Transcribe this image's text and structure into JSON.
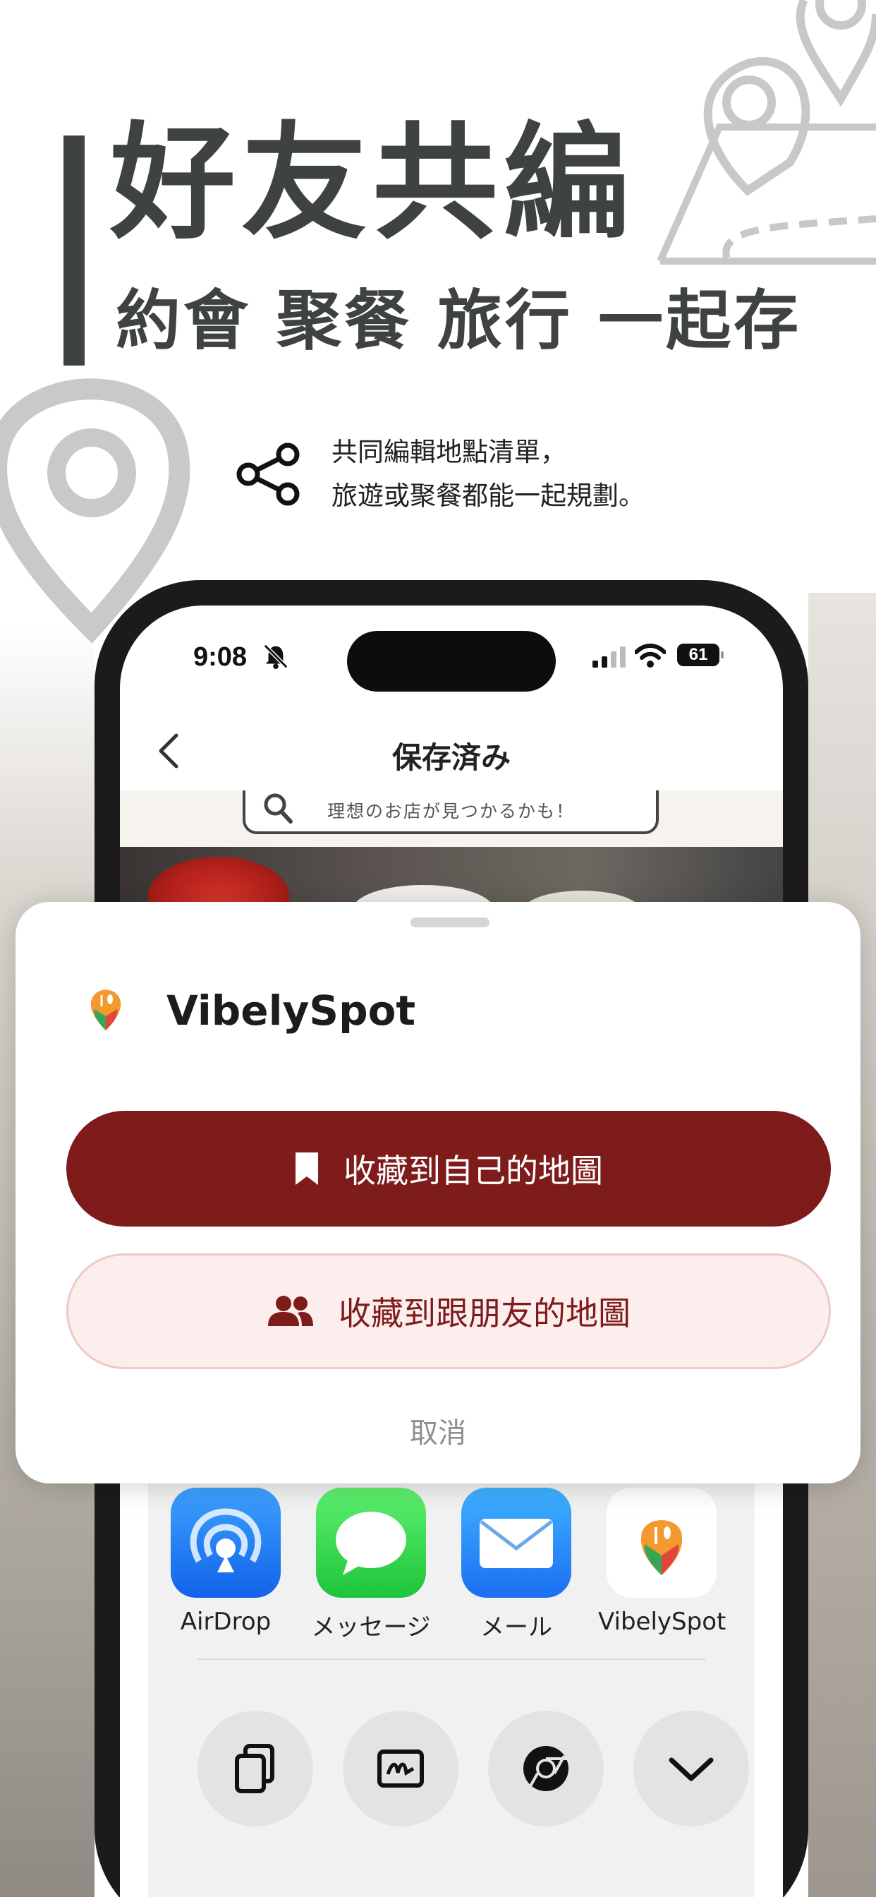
{
  "promo": {
    "headline": "好友共編",
    "subheadline": "約會 聚餐 旅行 一起存",
    "description_line1": "共同編輯地點清單，",
    "description_line2": "旅遊或聚餐都能一起規劃。"
  },
  "status_bar": {
    "time": "9:08",
    "battery": "61"
  },
  "nav": {
    "title": "保存済み"
  },
  "search": {
    "placeholder": "理想のお店が見つかるかも！"
  },
  "share_sheet": {
    "apps": [
      {
        "label": "AirDrop",
        "icon": "airdrop-icon"
      },
      {
        "label": "メッセージ",
        "icon": "messages-icon"
      },
      {
        "label": "メール",
        "icon": "mail-icon"
      },
      {
        "label": "VibelySpot",
        "icon": "vibelyspot-icon"
      }
    ],
    "actions": [
      "copy-icon",
      "markup-icon",
      "chrome-icon",
      "more-chevron-icon"
    ]
  },
  "dialog": {
    "app_name": "VibelySpot",
    "save_mine_label": "收藏到自己的地圖",
    "save_friends_label": "收藏到跟朋友的地圖",
    "cancel_label": "取消"
  },
  "colors": {
    "primary": "#7e1b1b",
    "secondary_bg": "#fdeeee",
    "headline": "#3e4240"
  }
}
